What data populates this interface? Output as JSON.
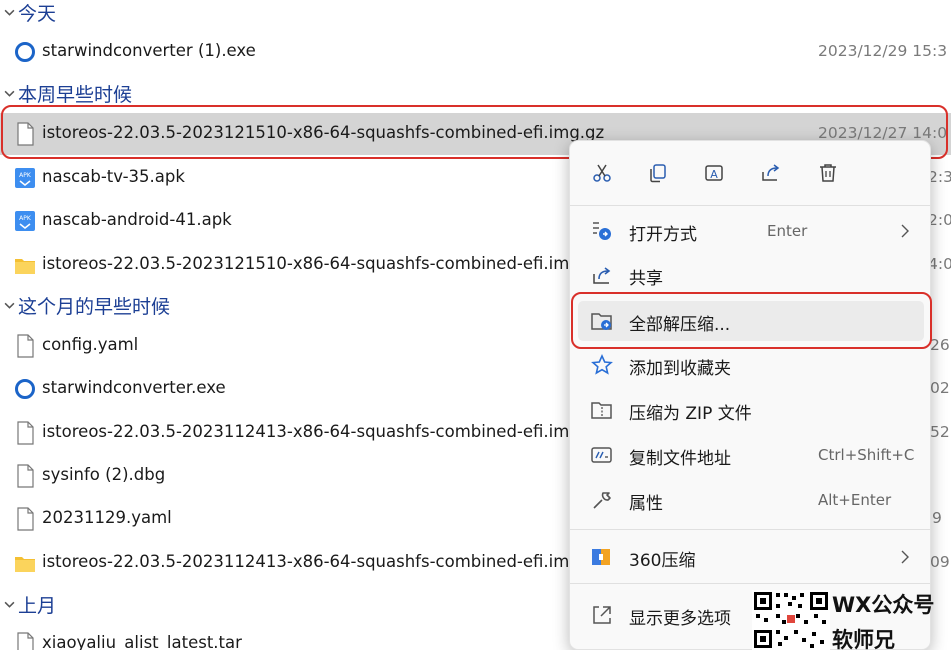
{
  "groups": [
    {
      "label": "今天"
    },
    {
      "label": "本周早些时候"
    },
    {
      "label": "这个月的早些时候"
    },
    {
      "label": "上月"
    }
  ],
  "files": [
    {
      "name": "starwindconverter (1).exe",
      "date": "2023/12/29 15:3",
      "icon": "starwind-app-icon"
    },
    {
      "name": "istoreos-22.03.5-2023121510-x86-64-squashfs-combined-efi.img.gz",
      "date": "2023/12/27 14:0",
      "icon": "file-icon"
    },
    {
      "name": "nascab-tv-35.apk",
      "date": "2:3",
      "icon": "apk-icon"
    },
    {
      "name": "nascab-android-41.apk",
      "date": "2:0",
      "icon": "apk-icon"
    },
    {
      "name": "istoreos-22.03.5-2023121510-x86-64-squashfs-combined-efi.img",
      "date": "4:0",
      "icon": "folder-icon"
    },
    {
      "name": "config.yaml",
      "date": "26",
      "icon": "file-icon"
    },
    {
      "name": "starwindconverter.exe",
      "date": "02",
      "icon": "starwind-app-icon"
    },
    {
      "name": "istoreos-22.03.5-2023112413-x86-64-squashfs-combined-efi.img",
      "date": "52",
      "icon": "file-icon"
    },
    {
      "name": "sysinfo (2).dbg",
      "date": "",
      "icon": "file-icon"
    },
    {
      "name": "20231129.yaml",
      "date": "9",
      "icon": "file-icon"
    },
    {
      "name": "istoreos-22.03.5-2023112413-x86-64-squashfs-combined-efi.img",
      "date": "09",
      "icon": "folder-icon"
    },
    {
      "name": "xiaoyaliu_alist_latest.tar",
      "date": "",
      "icon": "file-icon"
    }
  ],
  "context_menu": {
    "top_icons": [
      "cut-icon",
      "copy-icon",
      "rename-icon",
      "share-icon",
      "delete-icon"
    ],
    "items": [
      {
        "label": "打开方式",
        "shortcut": "Enter",
        "submenu": true,
        "icon": "open-with-icon"
      },
      {
        "label": "共享",
        "shortcut": "",
        "submenu": false,
        "icon": "share-icon"
      },
      {
        "label": "全部解压缩...",
        "shortcut": "",
        "submenu": false,
        "icon": "extract-all-icon"
      },
      {
        "label": "添加到收藏夹",
        "shortcut": "",
        "submenu": false,
        "icon": "star-icon"
      },
      {
        "label": "压缩为 ZIP 文件",
        "shortcut": "",
        "submenu": false,
        "icon": "zip-icon"
      },
      {
        "label": "复制文件地址",
        "shortcut": "Ctrl+Shift+C",
        "submenu": false,
        "icon": "copy-path-icon"
      },
      {
        "label": "属性",
        "shortcut": "Alt+Enter",
        "submenu": false,
        "icon": "wrench-icon"
      },
      {
        "label": "360压缩",
        "shortcut": "",
        "submenu": true,
        "icon": "360zip-icon"
      },
      {
        "label": "显示更多选项",
        "shortcut": "",
        "submenu": false,
        "icon": "more-options-icon"
      }
    ]
  },
  "watermark": {
    "line1": "WX公众号",
    "line2": "软师兄"
  },
  "colors": {
    "group_header": "#1c3f94",
    "highlight_box": "#d9302a",
    "selected_row": "#d4d4d4"
  }
}
